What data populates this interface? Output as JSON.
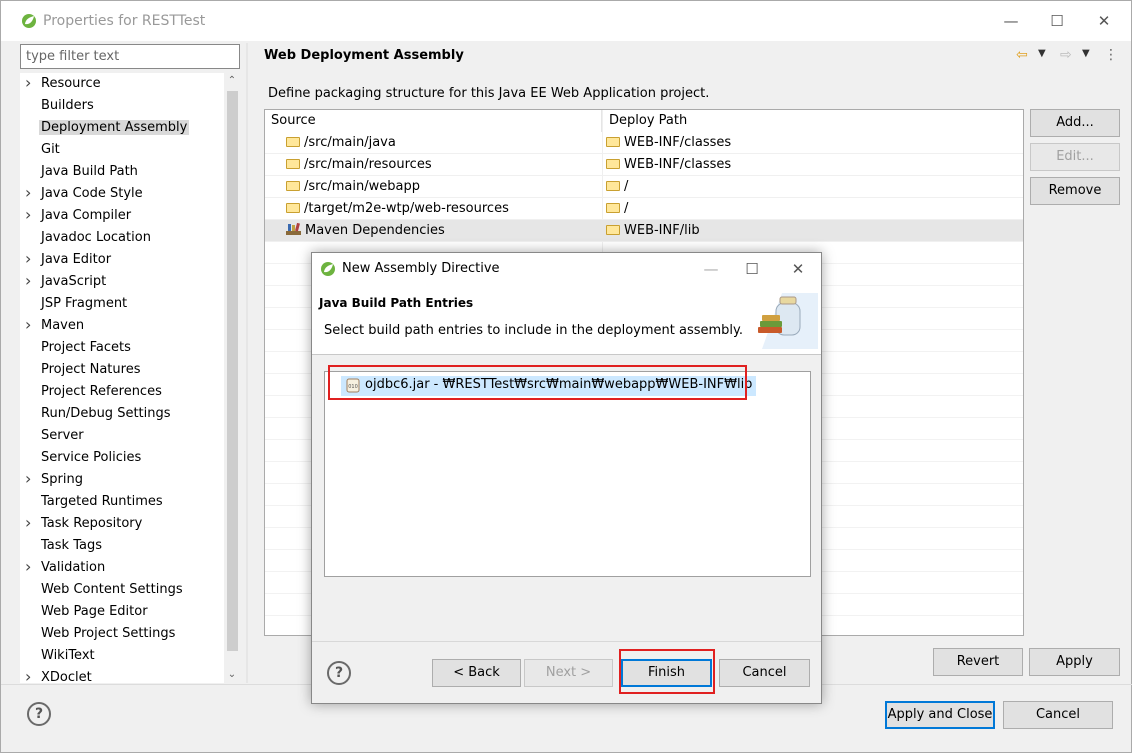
{
  "window": {
    "title": "Properties for RESTTest"
  },
  "filter": {
    "placeholder": "type filter text"
  },
  "tree": {
    "items": [
      {
        "label": "Resource",
        "expandable": true
      },
      {
        "label": "Builders",
        "expandable": false
      },
      {
        "label": "Deployment Assembly",
        "expandable": false,
        "selected": true
      },
      {
        "label": "Git",
        "expandable": false
      },
      {
        "label": "Java Build Path",
        "expandable": false
      },
      {
        "label": "Java Code Style",
        "expandable": true
      },
      {
        "label": "Java Compiler",
        "expandable": true
      },
      {
        "label": "Javadoc Location",
        "expandable": false
      },
      {
        "label": "Java Editor",
        "expandable": true
      },
      {
        "label": "JavaScript",
        "expandable": true
      },
      {
        "label": "JSP Fragment",
        "expandable": false
      },
      {
        "label": "Maven",
        "expandable": true
      },
      {
        "label": "Project Facets",
        "expandable": false
      },
      {
        "label": "Project Natures",
        "expandable": false
      },
      {
        "label": "Project References",
        "expandable": false
      },
      {
        "label": "Run/Debug Settings",
        "expandable": false
      },
      {
        "label": "Server",
        "expandable": false
      },
      {
        "label": "Service Policies",
        "expandable": false
      },
      {
        "label": "Spring",
        "expandable": true
      },
      {
        "label": "Targeted Runtimes",
        "expandable": false
      },
      {
        "label": "Task Repository",
        "expandable": true
      },
      {
        "label": "Task Tags",
        "expandable": false
      },
      {
        "label": "Validation",
        "expandable": true
      },
      {
        "label": "Web Content Settings",
        "expandable": false
      },
      {
        "label": "Web Page Editor",
        "expandable": false
      },
      {
        "label": "Web Project Settings",
        "expandable": false
      },
      {
        "label": "WikiText",
        "expandable": false
      },
      {
        "label": "XDoclet",
        "expandable": true
      }
    ]
  },
  "panel": {
    "title": "Web Deployment Assembly",
    "description": "Define packaging structure for this Java EE Web Application project.",
    "columns": {
      "source": "Source",
      "deploy": "Deploy Path"
    },
    "rows": [
      {
        "source": "/src/main/java",
        "deploy": "WEB-INF/classes",
        "icon": "folder-icon"
      },
      {
        "source": "/src/main/resources",
        "deploy": "WEB-INF/classes",
        "icon": "folder-icon"
      },
      {
        "source": "/src/main/webapp",
        "deploy": "/",
        "icon": "folder-icon"
      },
      {
        "source": "/target/m2e-wtp/web-resources",
        "deploy": "/",
        "icon": "folder-icon"
      },
      {
        "source": "Maven Dependencies",
        "deploy": "WEB-INF/lib",
        "icon": "library-icon",
        "selected": true
      }
    ],
    "buttons": {
      "add": "Add...",
      "edit": "Edit...",
      "remove": "Remove",
      "revert": "Revert",
      "apply": "Apply"
    }
  },
  "footer": {
    "apply_close": "Apply and Close",
    "cancel": "Cancel"
  },
  "dialog": {
    "title": "New Assembly Directive",
    "header_title": "Java Build Path Entries",
    "header_subtitle": "Select build path entries to include in the deployment assembly.",
    "entry": "ojdbc6.jar - ₩RESTTest₩src₩main₩webapp₩WEB-INF₩lib",
    "buttons": {
      "back": "< Back",
      "next": "Next >",
      "finish": "Finish",
      "cancel": "Cancel"
    }
  },
  "colors": {
    "accent": "#0078d7",
    "highlight": "#e02020",
    "selection": "#cce8ff"
  }
}
